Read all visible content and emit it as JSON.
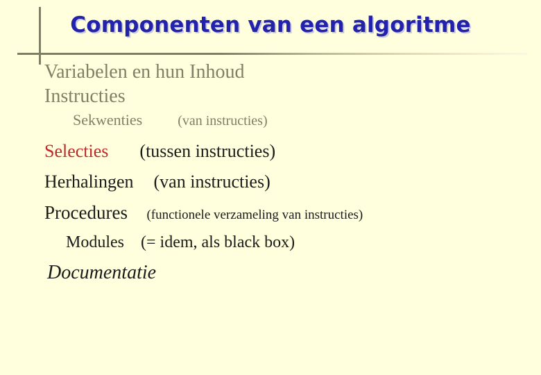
{
  "slide": {
    "background_color": "#FFFFDD",
    "title": "Componenten van een algoritme",
    "title_color": "#2222AA",
    "accent_gray": "#808066",
    "accent_red": "#BB2A2A",
    "body_black": "#1A1A1A"
  },
  "decorations": {
    "vertical_rule": "vertical-rule",
    "horizontal_rule": "horizontal-rule"
  },
  "body": {
    "lines": [
      {
        "id": "variabelen",
        "label": "Variabelen en hun Inhoud",
        "note": "",
        "color": "#808066"
      },
      {
        "id": "instructies",
        "label": "Instructies",
        "note": "",
        "color": "#808066"
      },
      {
        "id": "sekwenties",
        "label": "Sekwenties",
        "note": "(van instructies)",
        "color": "#808066"
      },
      {
        "id": "selecties",
        "label": "Selecties",
        "note": "(tussen instructies)",
        "color": "#BB2A2A"
      },
      {
        "id": "herhalingen",
        "label": "Herhalingen",
        "note": "(van instructies)",
        "color": "#1A1A1A"
      },
      {
        "id": "procedures",
        "label": "Procedures",
        "note": "(functionele verzameling van instructies)",
        "color": "#1A1A1A"
      },
      {
        "id": "modules",
        "label": "Modules",
        "note": "(= idem, als black box)",
        "color": "#1A1A1A"
      },
      {
        "id": "documentatie",
        "label": "Documentatie",
        "note": "",
        "color": "#1A1A1A"
      }
    ]
  }
}
